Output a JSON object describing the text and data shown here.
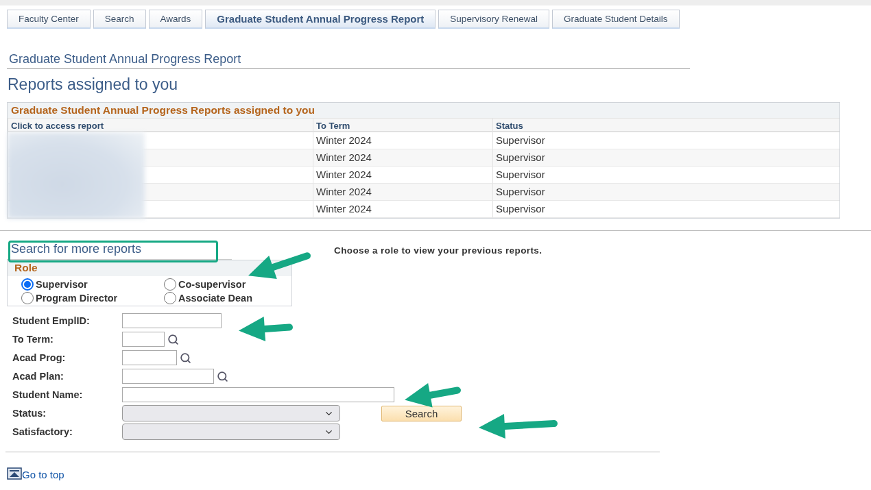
{
  "tabs": [
    {
      "label": "Faculty Center",
      "selected": false
    },
    {
      "label": "Search",
      "selected": false
    },
    {
      "label": "Awards",
      "selected": false
    },
    {
      "label": "Graduate Student Annual Progress Report",
      "selected": true
    },
    {
      "label": "Supervisory Renewal",
      "selected": false
    },
    {
      "label": "Graduate Student Details",
      "selected": false
    }
  ],
  "page_title": "Graduate Student Annual Progress Report",
  "heading": "Reports assigned to you",
  "reports_table": {
    "title": "Graduate Student Annual Progress Reports assigned to you",
    "columns": [
      "Click to access report",
      "To Term",
      "Status"
    ],
    "rows": [
      {
        "to_term": "Winter 2024",
        "status": "Supervisor"
      },
      {
        "to_term": "Winter 2024",
        "status": "Supervisor"
      },
      {
        "to_term": "Winter 2024",
        "status": "Supervisor"
      },
      {
        "to_term": "Winter 2024",
        "status": "Supervisor"
      },
      {
        "to_term": "Winter 2024",
        "status": "Supervisor"
      }
    ]
  },
  "search_section": {
    "title": "Search for more reports",
    "hint": "Choose a role to view your previous reports.",
    "role": {
      "label": "Role",
      "options": [
        {
          "label": "Supervisor",
          "selected": true
        },
        {
          "label": "Co-supervisor",
          "selected": false
        },
        {
          "label": "Program Director",
          "selected": false
        },
        {
          "label": "Associate Dean",
          "selected": false
        }
      ]
    },
    "fields": [
      {
        "label": "Student EmplID:",
        "kind": "text"
      },
      {
        "label": "To Term:",
        "kind": "lookup"
      },
      {
        "label": "Acad Prog:",
        "kind": "lookup"
      },
      {
        "label": "Acad Plan:",
        "kind": "lookup"
      },
      {
        "label": "Student Name:",
        "kind": "text"
      },
      {
        "label": "Status:",
        "kind": "select"
      },
      {
        "label": "Satisfactory:",
        "kind": "select"
      }
    ],
    "search_button": "Search"
  },
  "go_to_top": "Go to top"
}
